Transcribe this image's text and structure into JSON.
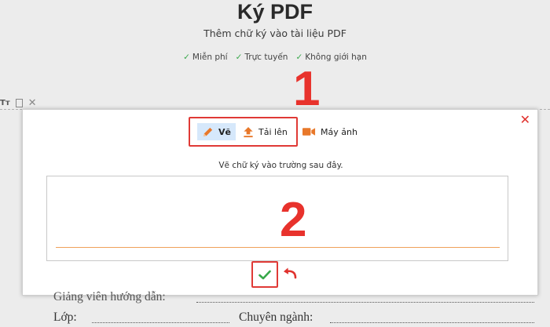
{
  "header": {
    "title": "Ký PDF",
    "subtitle": "Thêm chữ ký vào tài liệu PDF",
    "features": [
      {
        "label": "Miễn phí"
      },
      {
        "label": "Trực tuyến"
      },
      {
        "label": "Không giới hạn"
      }
    ]
  },
  "doc_toolbar": {
    "text_tool": "Tт"
  },
  "annotations": {
    "step1": "1",
    "step2": "2"
  },
  "modal": {
    "tabs": [
      {
        "label": "Vẽ",
        "icon": "pencil-icon",
        "active": true
      },
      {
        "label": "Tải lên",
        "icon": "upload-icon",
        "active": false
      },
      {
        "label": "Máy ảnh",
        "icon": "camera-icon",
        "active": false
      }
    ],
    "instruction": "Vẽ chữ ký vào trường sau đây."
  },
  "document": {
    "behind_line": "Giảng viên hướng dẫn:",
    "field_class": "Lớp:",
    "field_major": "Chuyên ngành:"
  },
  "colors": {
    "accent_red": "#e03a36",
    "tab_active_bg": "#d6e8fb",
    "orange": "#e8782a",
    "check_green": "#38a84a"
  }
}
